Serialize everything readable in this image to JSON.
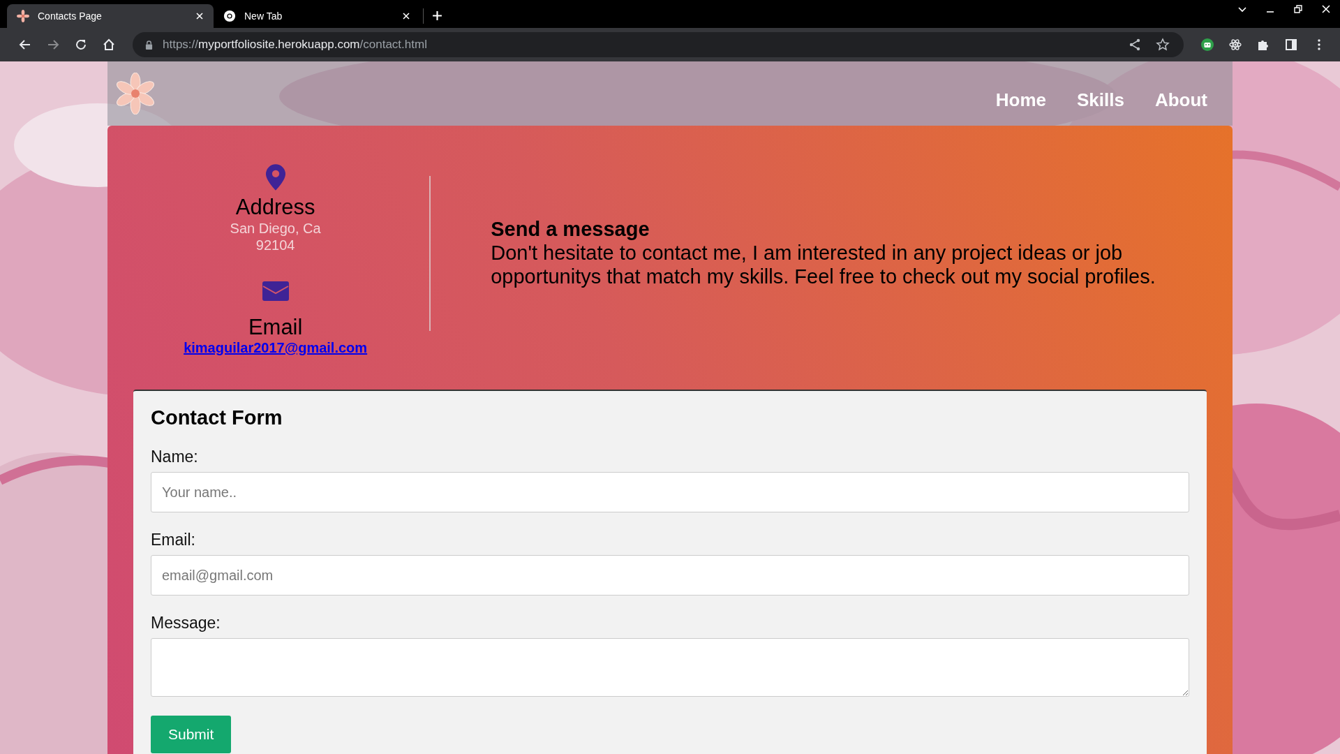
{
  "browser": {
    "tabs": [
      {
        "title": "Contacts Page",
        "kind": "site",
        "selected": true
      },
      {
        "title": "New Tab",
        "kind": "newtab",
        "selected": false
      }
    ],
    "url": {
      "scheme": "https://",
      "host": "myportfoliosite.herokuapp.com",
      "path": "/contact.html"
    }
  },
  "nav": [
    "Home",
    "Skills",
    "About"
  ],
  "contact_info": [
    {
      "kind": "address",
      "heading": "Address",
      "lines": [
        "San Diego, Ca",
        "92104"
      ]
    },
    {
      "kind": "email",
      "heading": "Email",
      "link": "kimaguilar2017@gmail.com"
    }
  ],
  "message": {
    "title": "Send a message",
    "body": "Don't hesitate to contact me, I am interested in any project ideas or job opportunitys that match my skills. Feel free to check out my social profiles."
  },
  "form": {
    "title": "Contact Form",
    "fields": [
      {
        "kind": "input",
        "label": "Name:",
        "placeholder": "Your name.."
      },
      {
        "kind": "input",
        "label": "Email:",
        "placeholder": "email@gmail.com"
      },
      {
        "kind": "textarea",
        "label": "Message:"
      }
    ],
    "submit": "Submit"
  }
}
